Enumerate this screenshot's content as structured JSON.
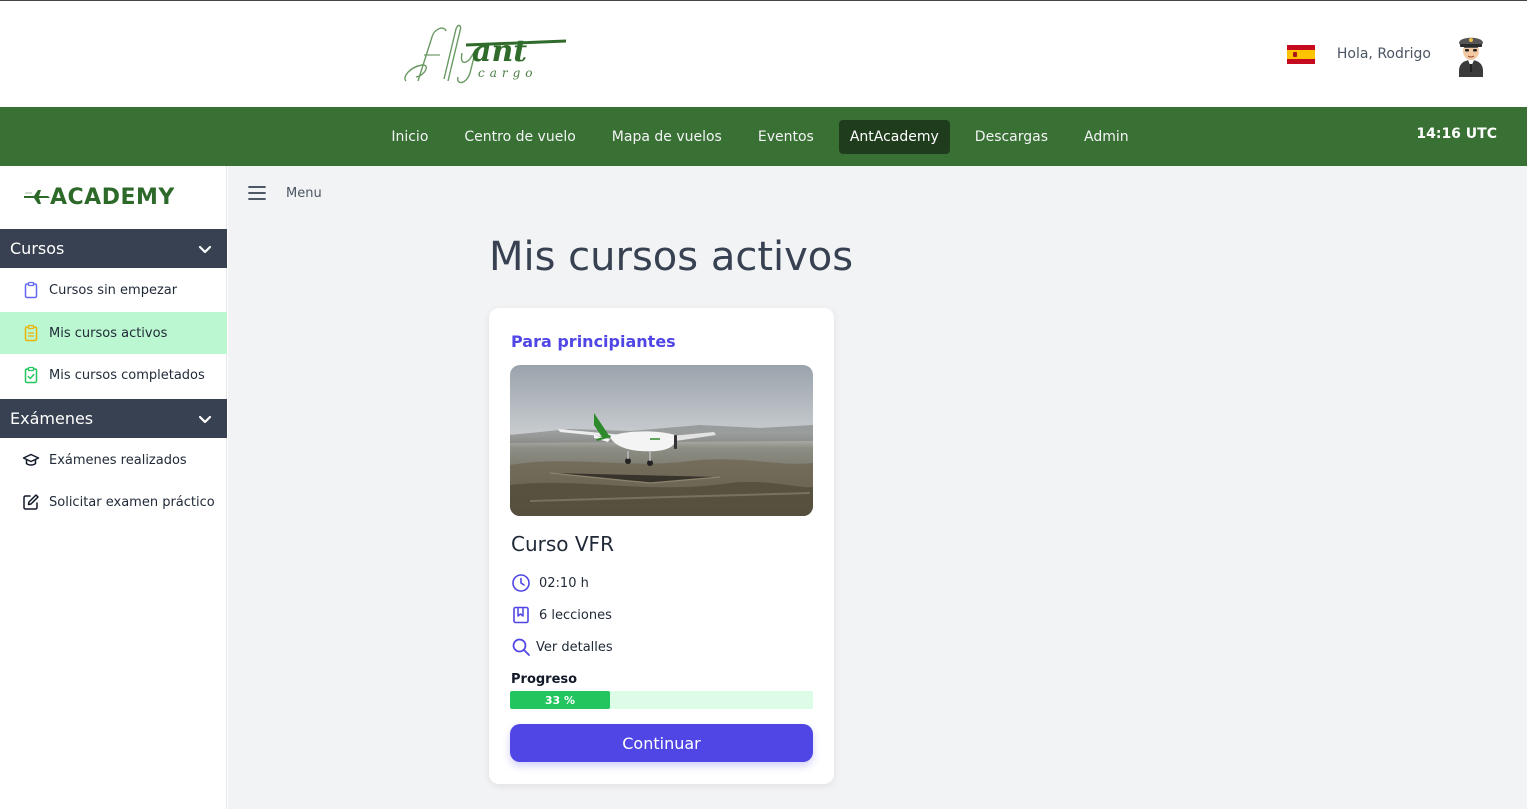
{
  "header": {
    "logo_text": "flyant",
    "logo_sub": "cargo",
    "greeting": "Hola, Rodrigo",
    "flag_icon": "spain-flag-icon",
    "avatar_icon": "pilot-avatar-icon"
  },
  "navbar": {
    "items": [
      {
        "label": "Inicio"
      },
      {
        "label": "Centro de vuelo"
      },
      {
        "label": "Mapa de vuelos"
      },
      {
        "label": "Eventos"
      },
      {
        "label": "AntAcademy",
        "active": true
      },
      {
        "label": "Descargas"
      },
      {
        "label": "Admin"
      }
    ],
    "time": "14:16 UTC"
  },
  "sidebar": {
    "logo_text": "ACADEMY",
    "sections": [
      {
        "title": "Cursos",
        "items": [
          {
            "label": "Cursos sin empezar",
            "icon": "clipboard-icon"
          },
          {
            "label": "Mis cursos activos",
            "icon": "clipboard-list-icon",
            "active": true
          },
          {
            "label": "Mis cursos completados",
            "icon": "clipboard-check-icon"
          }
        ]
      },
      {
        "title": "Exámenes",
        "items": [
          {
            "label": "Exámenes realizados",
            "icon": "graduation-cap-icon"
          },
          {
            "label": "Solicitar examen práctico",
            "icon": "edit-icon"
          }
        ]
      }
    ]
  },
  "main": {
    "menu_label": "Menu",
    "title": "Mis cursos activos",
    "card": {
      "category": "Para principiantes",
      "title": "Curso VFR",
      "duration": "02:10 h",
      "lessons": "6 lecciones",
      "details_link": "Ver detalles",
      "progress_label": "Progreso",
      "progress_value": 33,
      "progress_text": "33 %",
      "button_label": "Continuar"
    }
  },
  "colors": {
    "navbar": "#397034",
    "nav_active": "#1f3d1d",
    "sidebar_section": "#374151",
    "active_item": "#bbf7d0",
    "accent": "#4f46e5",
    "progress": "#22c55e",
    "progress_track": "#dcfce7"
  }
}
